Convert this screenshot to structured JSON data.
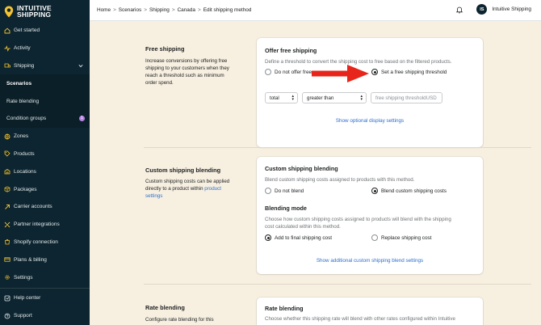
{
  "brand": {
    "line1": "INTUITIVE",
    "line2": "SHIPPING"
  },
  "sidebar": {
    "items": [
      {
        "label": "Get started",
        "icon": "home-icon"
      },
      {
        "label": "Activity",
        "icon": "activity-icon"
      },
      {
        "label": "Shipping",
        "icon": "shipping-icon"
      },
      {
        "label": "Scenarios"
      },
      {
        "label": "Rate blending"
      },
      {
        "label": "Condition groups",
        "badge": "1"
      },
      {
        "label": "Zones",
        "icon": "globe-icon"
      },
      {
        "label": "Products",
        "icon": "tag-icon"
      },
      {
        "label": "Locations",
        "icon": "location-icon"
      },
      {
        "label": "Packages",
        "icon": "package-icon"
      },
      {
        "label": "Carrier accounts",
        "icon": "carrier-icon"
      },
      {
        "label": "Partner integrations",
        "icon": "puzzle-icon"
      },
      {
        "label": "Shopify connection",
        "icon": "shopify-icon"
      },
      {
        "label": "Plans & billing",
        "icon": "card-icon"
      },
      {
        "label": "Settings",
        "icon": "gear-icon"
      },
      {
        "label": "Help center",
        "icon": "help-icon"
      },
      {
        "label": "Support",
        "icon": "support-icon"
      }
    ]
  },
  "breadcrumb": [
    "Home",
    "Scenarios",
    "Shipping",
    "Canada",
    "Edit shipping method"
  ],
  "user": {
    "initials": "IS",
    "name": "Intuitive Shipping"
  },
  "free_shipping": {
    "section_title": "Free shipping",
    "section_desc": "Increase conversions by offering free shipping to your customers when they reach a threshold such as minimum order spend.",
    "card_title": "Offer free shipping",
    "card_desc": "Define a threshold to convert the shipping cost to free based on the filtered products.",
    "option_off": "Do not offer free s",
    "option_on": "Set a free shipping threshold",
    "select_total": "total",
    "select_operator": "greater than",
    "threshold_placeholder": "free shipping threshold",
    "threshold_unit": "USD",
    "link": "Show optional display settings"
  },
  "custom_blending": {
    "section_title": "Custom shipping blending",
    "section_desc": "Custom shipping costs can be applied directly to a product within",
    "section_desc_link": "product settings",
    "card_title": "Custom shipping blending",
    "card_desc": "Blend custom shipping costs assigned to products with this method.",
    "option_off": "Do not blend",
    "option_on": "Blend custom shipping costs",
    "mode_title": "Blending mode",
    "mode_desc": "Choose how custom shipping costs assigned to products will blend with the shipping cost calculated within this method.",
    "mode_add": "Add to final shipping cost",
    "mode_replace": "Replace shipping cost",
    "link": "Show additional custom shipping blend settings"
  },
  "rate_blending": {
    "section_title": "Rate blending",
    "section_desc": "Configure rate blending for this",
    "card_title": "Rate blending",
    "card_desc": "Choose whether this shipping rate will blend with other rates configured within Intuitive"
  },
  "colors": {
    "sidebar": "#0d2530",
    "background": "#f7f0e1",
    "link": "#2c6ecb",
    "arrow": "#e8251a"
  }
}
